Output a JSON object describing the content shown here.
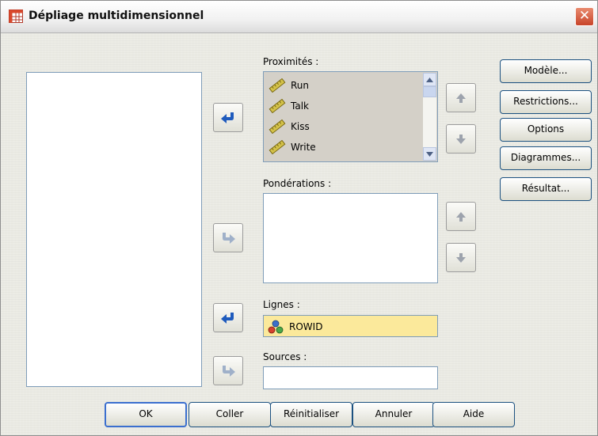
{
  "window": {
    "title": "Dépliage multidimensionnel"
  },
  "variables": {
    "items": []
  },
  "proximities": {
    "label": "Proximités :",
    "items": [
      "Run",
      "Talk",
      "Kiss",
      "Write"
    ]
  },
  "weights": {
    "label": "Pondérations :",
    "items": []
  },
  "rows": {
    "label": "Lignes :",
    "value": "ROWID"
  },
  "sources": {
    "label": "Sources :",
    "value": ""
  },
  "side_buttons": {
    "model": "Modèle...",
    "restrictions": "Restrictions...",
    "options": "Options",
    "plots": "Diagrammes...",
    "output": "Résultat..."
  },
  "bottom_buttons": {
    "ok": "OK",
    "paste": "Coller",
    "reset": "Réinitialiser",
    "cancel": "Annuler",
    "help": "Aide"
  },
  "colors": {
    "arrow_active": "#1f5bbd",
    "arrow_disabled": "#9fb0c9",
    "scale_icon": "#d4c24a",
    "rows_bg": "#fbe99b"
  },
  "icons": {
    "variable_type": "ruler-scale-icon",
    "rows_type": "nominal-circles-icon",
    "move_in": "arrow-left-icon",
    "move_out": "arrow-right-icon"
  }
}
